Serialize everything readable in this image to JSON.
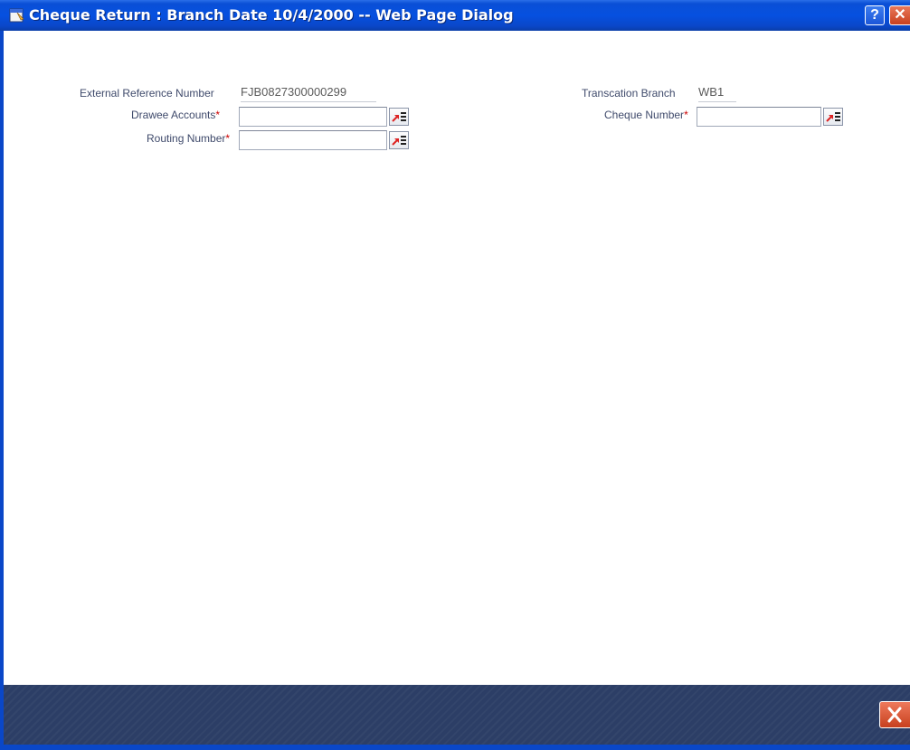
{
  "window": {
    "title": "Cheque Return : Branch Date 10/4/2000 -- Web Page Dialog",
    "help_glyph": "?",
    "close_glyph": "✕"
  },
  "form": {
    "external_reference": {
      "label": "External Reference Number",
      "value": "FJB0827300000299"
    },
    "drawee_accounts": {
      "label": "Drawee Accounts",
      "required_mark": "*",
      "value": ""
    },
    "routing_number": {
      "label": "Routing Number",
      "required_mark": "*",
      "value": ""
    },
    "transaction_branch": {
      "label": "Transcation Branch",
      "value": "WB1"
    },
    "cheque_number": {
      "label": "Cheque Number",
      "required_mark": "*",
      "value": ""
    }
  },
  "icons": {
    "lov": "list-of-values-icon",
    "exit": "close-icon"
  },
  "colors": {
    "titlebar": "#0650e0",
    "footer": "#2c3e66",
    "required": "#cc0000",
    "exit_button": "#c8401e"
  }
}
